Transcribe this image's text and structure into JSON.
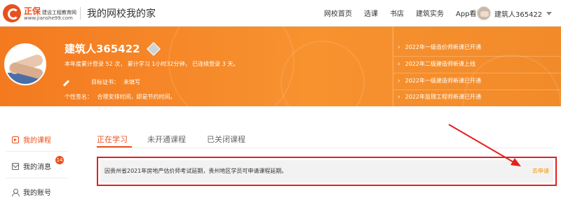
{
  "header": {
    "logo_name": "正保",
    "logo_sub": "建设工程教育网",
    "logo_url": "www.jianshe99.com",
    "site_title": "我的网校我的家",
    "nav": [
      "网校首页",
      "选课",
      "书店",
      "建筑实务",
      "App看课"
    ],
    "user_name": "建筑人365422"
  },
  "profile": {
    "name": "建筑人365422",
    "stats": "本年度累计登录 52 次，  累计学习 1小时32分钟，  已连续登录 3 天。",
    "cert_label": "目标证书：",
    "cert_value": "未填写",
    "sign_label": "个性签名：",
    "sign_value": "合理安排时间，即是节约时间。"
  },
  "news": [
    "2022年一级造价师新课已开通",
    "2022年二级建造师新课上线",
    "2022年一级建造师新课已开通",
    "2022年监理工程师新课已开通"
  ],
  "sidebar": {
    "items": [
      {
        "label": "我的课程",
        "icon": "course-icon"
      },
      {
        "label": "我的消息",
        "icon": "mail-icon"
      },
      {
        "label": "我的账号",
        "icon": "user-icon"
      }
    ],
    "message_count": "14"
  },
  "tabs": [
    "正在学习",
    "未开通课程",
    "已关闭课程"
  ],
  "notice": {
    "text": "因贵州省2021年房地产估价师考试延期，贵州地区学员可申请课程延期。",
    "link": "去申请"
  },
  "colors": {
    "accent": "#e8501f",
    "banner": "#f7922f",
    "highlight_box": "#e61e1e",
    "link": "#f39800"
  }
}
